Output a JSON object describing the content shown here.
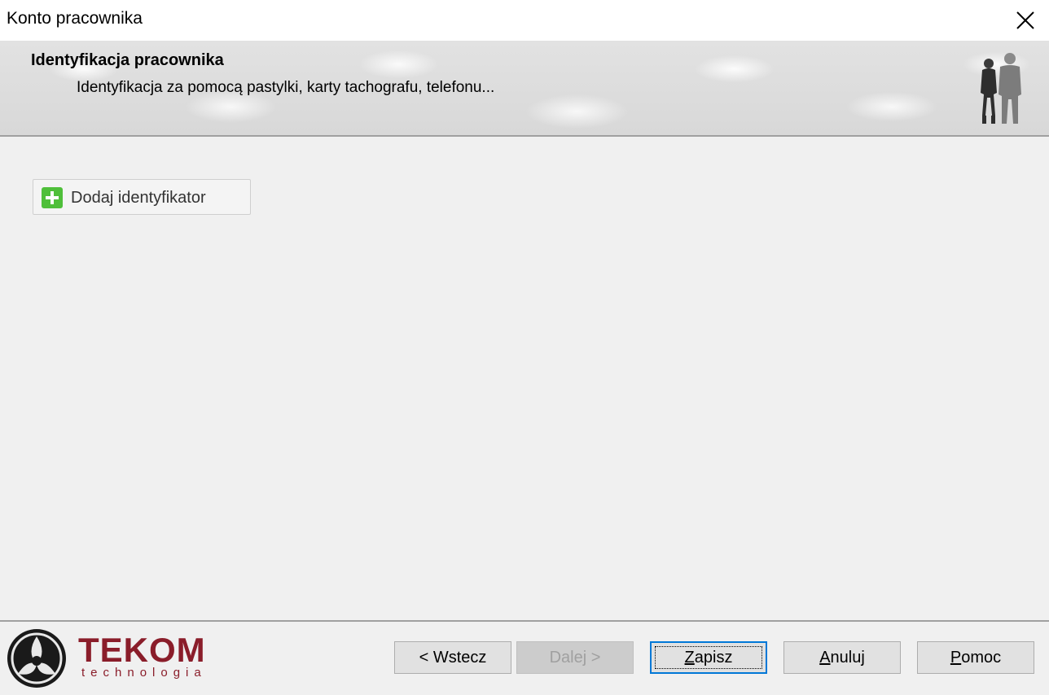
{
  "window": {
    "title": "Konto pracownika",
    "close_icon": "close-icon"
  },
  "header": {
    "title": "Identyfikacja pracownika",
    "subtitle": "Identyfikacja za pomocą pastylki, karty tachografu, telefonu...",
    "image_icon": "people-silhouette-icon"
  },
  "content": {
    "add_button": {
      "label": "Dodaj identyfikator",
      "icon": "add-icon",
      "icon_color": "#4fbf3a"
    }
  },
  "footer": {
    "logo": {
      "name": "TEKOM",
      "tagline": "technologia",
      "color": "#8a1d2a"
    },
    "buttons": {
      "back": {
        "label": "< Wstecz",
        "enabled": true
      },
      "next": {
        "label": "Dalej >",
        "enabled": false
      },
      "save_mnemonic": "Z",
      "save_rest": "apisz",
      "cancel_mnemonic": "A",
      "cancel_rest": "nuluj",
      "help_mnemonic": "P",
      "help_rest": "omoc"
    },
    "focus_color": "#0078d7"
  }
}
